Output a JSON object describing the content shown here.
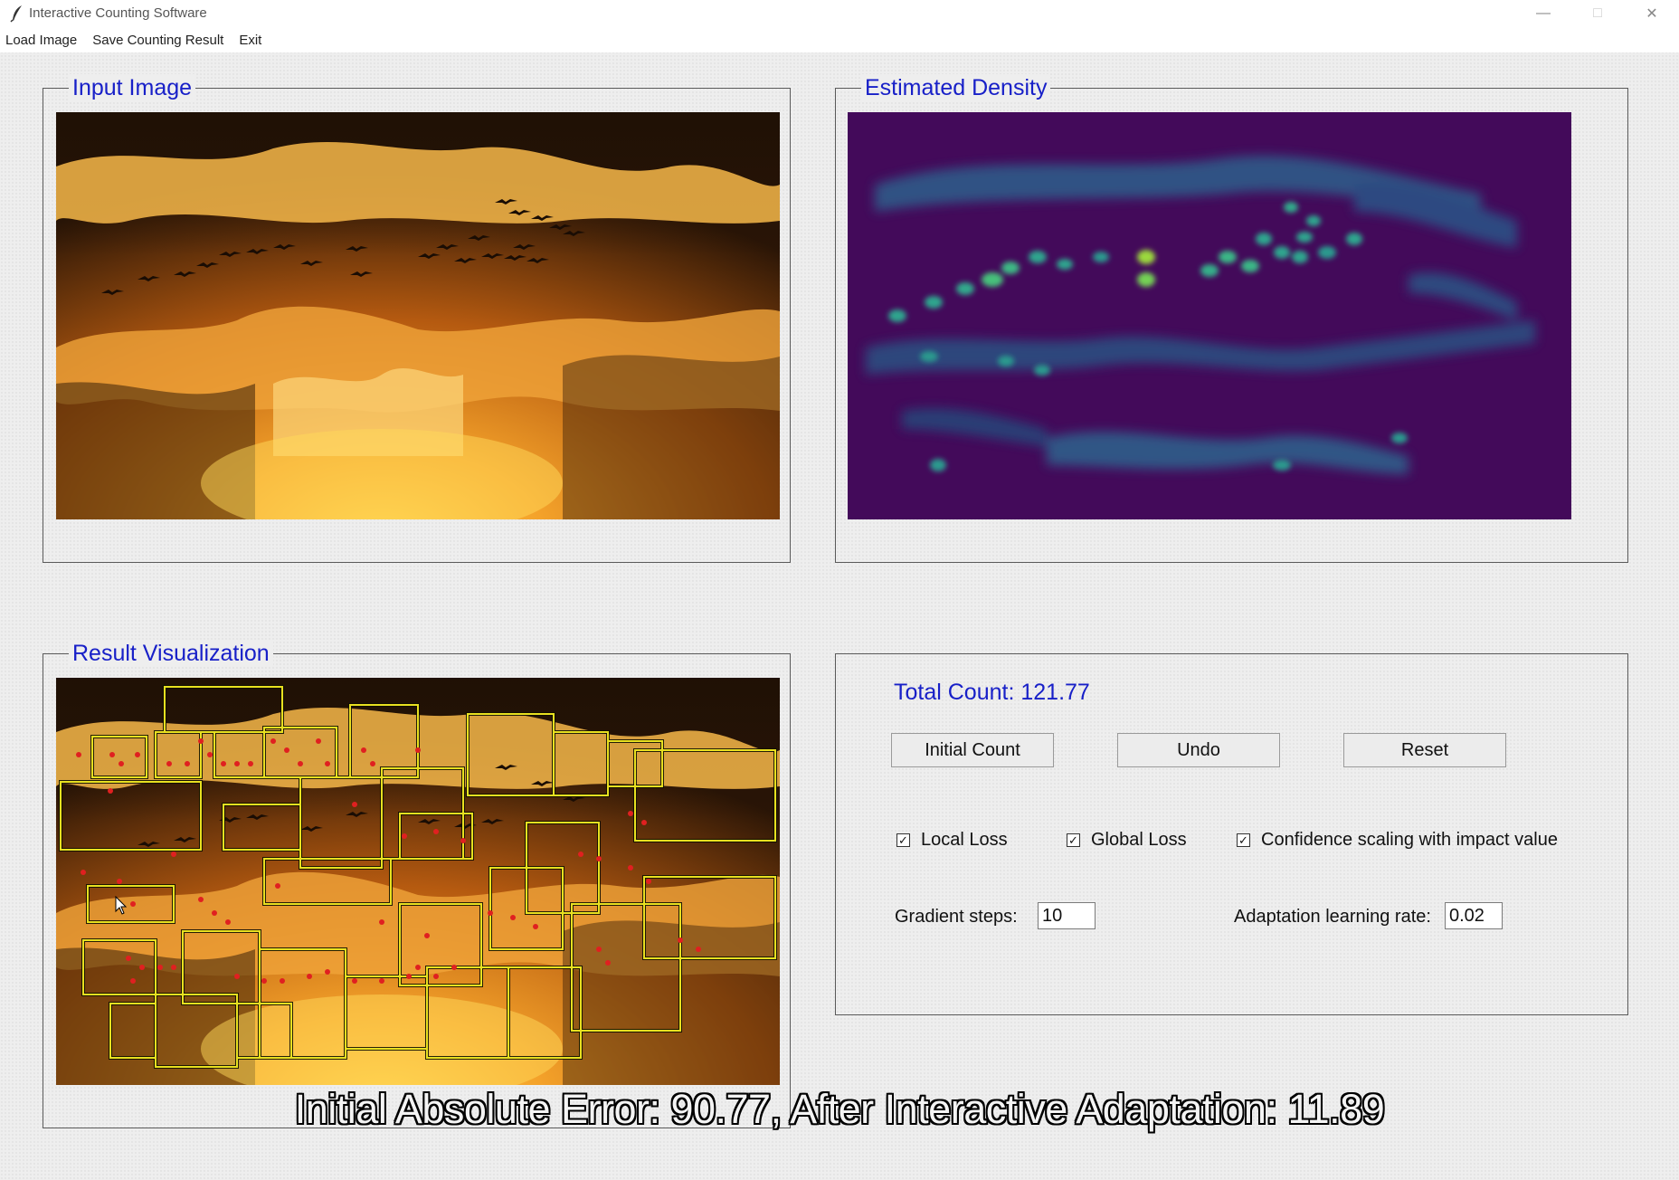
{
  "window": {
    "title": "Interactive Counting Software",
    "minimize_icon": "minimize-icon",
    "maximize_icon": "maximize-icon",
    "close_icon": "close-icon"
  },
  "menu": {
    "items": [
      "Load Image",
      "Save Counting Result",
      "Exit"
    ]
  },
  "panels": {
    "input_image": {
      "title": "Input Image",
      "image": "sunset sky with flock of birds"
    },
    "density": {
      "title": "Estimated Density",
      "image": "density heatmap (viridis)"
    },
    "result": {
      "title": "Result Visualization",
      "image": "sunset sky with yellow region outlines and red dots"
    }
  },
  "controls": {
    "total_count": "Total Count: 121.77",
    "buttons": {
      "initial_count": "Initial Count",
      "undo": "Undo",
      "reset": "Reset"
    },
    "checkboxes": {
      "local_loss": {
        "label": "Local Loss",
        "checked": true
      },
      "global_loss": {
        "label": "Global Loss",
        "checked": true
      },
      "confidence": {
        "label": "Confidence scaling with impact value",
        "checked": true
      }
    },
    "gradient_steps": {
      "label": "Gradient steps:",
      "value": "10"
    },
    "learning_rate": {
      "label": "Adaptation learning rate:",
      "value": "0.02"
    }
  },
  "caption": "Initial Absolute Error: 90.77, After Interactive Adaptation: 11.89",
  "colors": {
    "group_title": "#1820c8",
    "sky_dark": "#3a2008",
    "sky_orange": "#e08a20",
    "density_bg": "#430a5a",
    "outline": "#e8e020",
    "dot": "#e02020"
  }
}
